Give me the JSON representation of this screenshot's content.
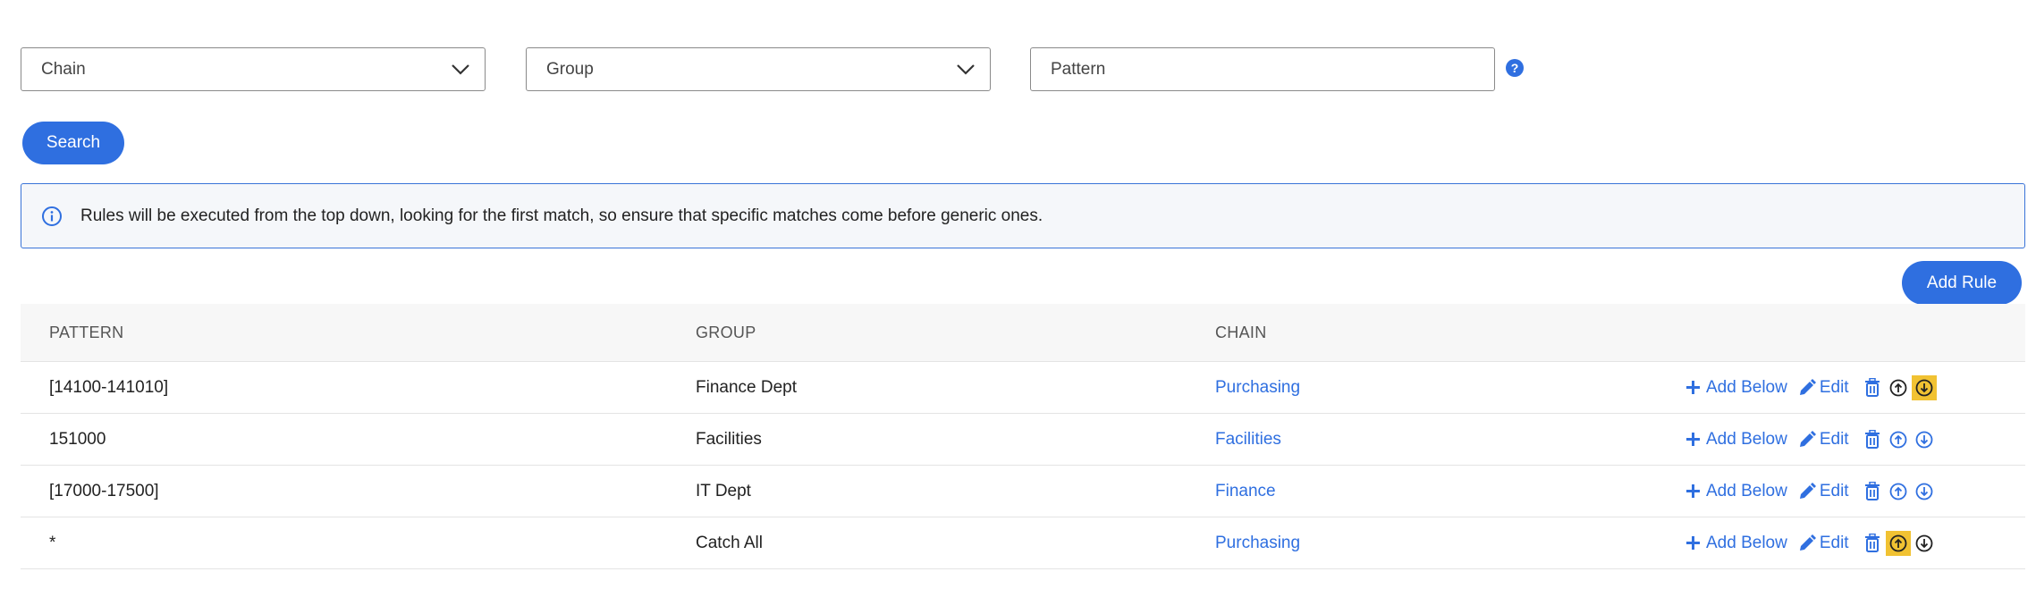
{
  "filters": {
    "chain_placeholder": "Chain",
    "group_placeholder": "Group",
    "pattern_placeholder": "Pattern"
  },
  "search_label": "Search",
  "info_text": "Rules will be executed from the top down, looking for the first match, so ensure that specific matches come before generic ones.",
  "add_rule_label": "Add Rule",
  "table": {
    "headers": {
      "pattern": "PATTERN",
      "group": "GROUP",
      "chain": "CHAIN"
    },
    "rows": [
      {
        "pattern": "[14100-141010]",
        "group": "Finance Dept",
        "chain": "Purchasing",
        "highlight": "down"
      },
      {
        "pattern": "151000",
        "group": "Facilities",
        "chain": "Facilities",
        "highlight": ""
      },
      {
        "pattern": "[17000-17500]",
        "group": "IT Dept",
        "chain": "Finance",
        "highlight": ""
      },
      {
        "pattern": "*",
        "group": "Catch All",
        "chain": "Purchasing",
        "highlight": "up"
      }
    ]
  },
  "actions": {
    "add_below": "Add Below",
    "edit": "Edit"
  },
  "icons": {
    "help": "question-circle-icon",
    "info": "info-circle-icon",
    "add": "plus-icon",
    "edit": "pencil-icon",
    "delete": "trash-icon",
    "up": "arrow-circle-up-icon",
    "down": "arrow-circle-down-icon"
  },
  "colors": {
    "accent": "#2f6fe0",
    "highlight": "#f1c232",
    "info_border": "#3a74d8"
  }
}
